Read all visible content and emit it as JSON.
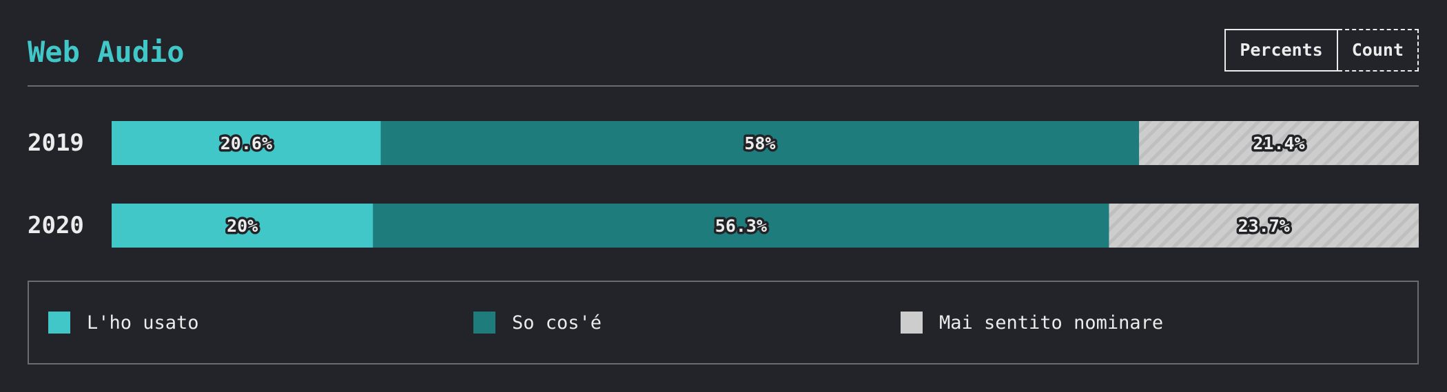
{
  "header": {
    "title": "Web Audio",
    "toggle": {
      "percents_label": "Percents",
      "count_label": "Count",
      "active": "percents"
    }
  },
  "colors": {
    "background": "#232429",
    "accent": "#41c7c7",
    "used": "#41c7c7",
    "know": "#1e7c7c",
    "never": "#cdcdcd",
    "border": "#6b6c72"
  },
  "chart_data": {
    "type": "bar",
    "orientation": "horizontal",
    "stacked": true,
    "normalized": true,
    "categories": [
      "2019",
      "2020"
    ],
    "series": [
      {
        "name": "L'ho usato",
        "color": "#41c7c7",
        "values": [
          20.6,
          20
        ],
        "labels": [
          "20.6%",
          "20%"
        ]
      },
      {
        "name": "So cos'é",
        "color": "#1e7c7c",
        "values": [
          58,
          56.3
        ],
        "labels": [
          "58%",
          "56.3%"
        ]
      },
      {
        "name": "Mai sentito nominare",
        "color": "#cdcdcd",
        "pattern": "diagonal-stripes",
        "values": [
          21.4,
          23.7
        ],
        "labels": [
          "21.4%",
          "23.7%"
        ]
      }
    ],
    "xlim": [
      0,
      100
    ],
    "grid": false,
    "legend": "bottom"
  },
  "legend": {
    "items": [
      {
        "label": "L'ho usato",
        "color": "#41c7c7"
      },
      {
        "label": "So cos'é",
        "color": "#1e7c7c"
      },
      {
        "label": "Mai sentito nominare",
        "color": "#cdcdcd"
      }
    ]
  }
}
